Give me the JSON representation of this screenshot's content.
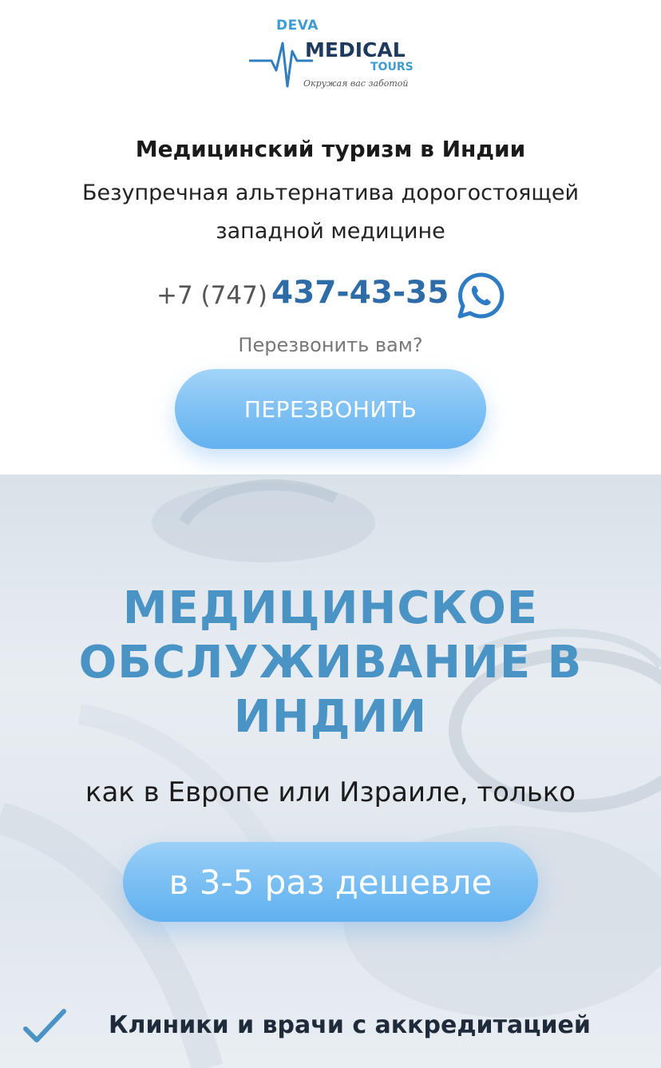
{
  "header": {
    "logo": {
      "line1": "DEVA",
      "line2": "MEDICAL",
      "line3": "TOURS",
      "tagline": "Окружая вас заботой"
    },
    "title": "Медицинский туризм в Индии",
    "subtitle": "Безупречная альтернатива дорогостоящей западной медицине",
    "phone_prefix": "+7 (747)",
    "phone_number": "437-43-35",
    "callback_question": "Перезвонить вам?",
    "callback_button": "ПЕРЕЗВОНИТЬ"
  },
  "hero": {
    "title": "МЕДИЦИНСКОЕ ОБСЛУЖИВАНИЕ В ИНДИИ",
    "subtitle": "как в Европе или Израиле, только",
    "cheap_button": "в 3-5 раз дешевле",
    "feature": "Клиники и врачи с аккредитацией"
  },
  "icons": {
    "whatsapp": "whatsapp-icon",
    "checkmark": "checkmark-icon",
    "pulse": "heartbeat-pulse-icon"
  },
  "colors": {
    "accent": "#4a93c5",
    "phone": "#2e6ca8",
    "button": "#7fc1f4"
  }
}
